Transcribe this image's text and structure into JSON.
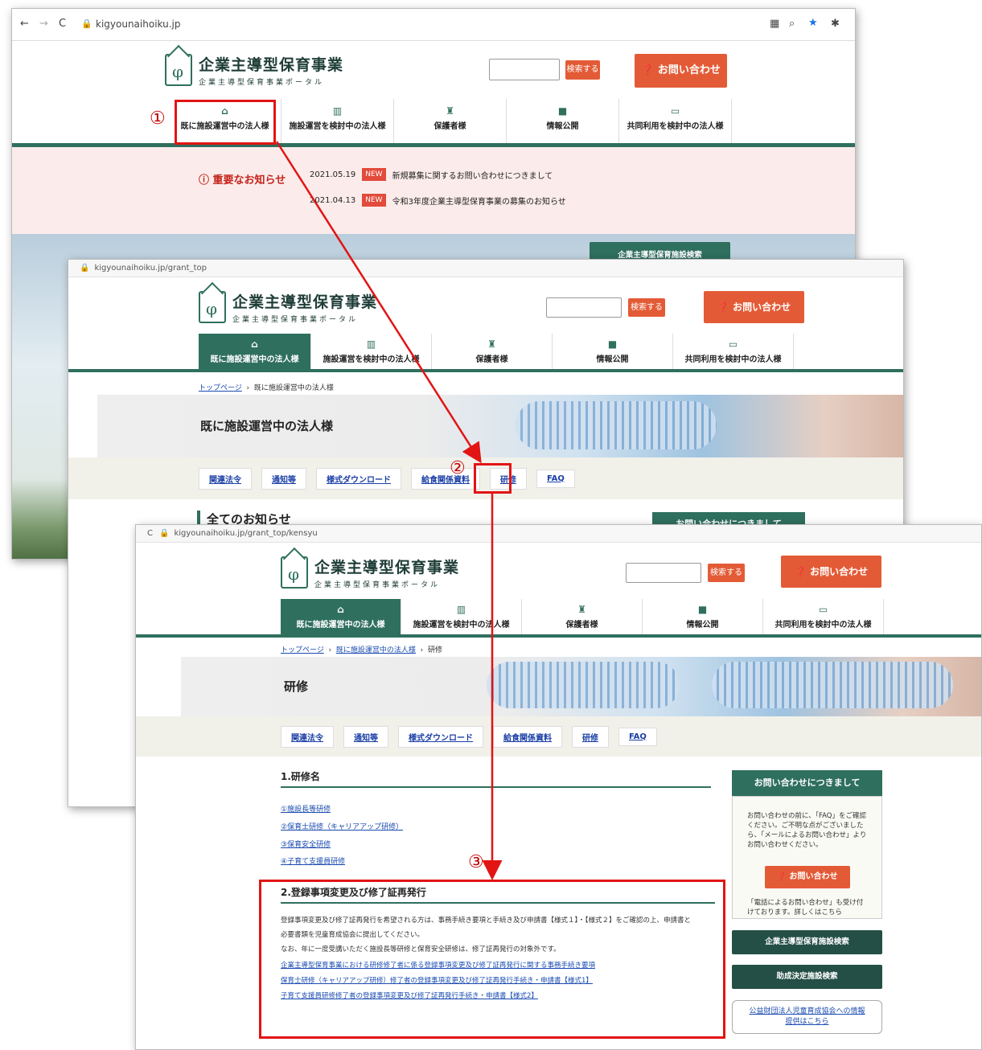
{
  "site": {
    "name": "企業主導型保育事業",
    "sub": "企業主導型保育事業ポータル",
    "search_btn": "検索する",
    "contact_btn": "お問い合わせ"
  },
  "nav": [
    "既に施設運営中の法人様",
    "施設運営を検討中の法人様",
    "保護者様",
    "情報公開",
    "共同利用を検討中の法人様"
  ],
  "nav_icons": [
    "home-icon",
    "building-icon",
    "family-icon",
    "folder-icon",
    "chat-icon"
  ],
  "w1": {
    "url": "kigyounaihoiku.jp",
    "notice_title": "重要なお知らせ",
    "notices": [
      {
        "date": "2021.05.19",
        "badge": "NEW",
        "text": "新規募集に関するお問い合わせにつきまして"
      },
      {
        "date": "2021.04.13",
        "badge": "NEW",
        "text": "令和3年度企業主導型保育事業の募集のお知らせ"
      }
    ],
    "facility_btn": "企業主導型保育施設検索"
  },
  "w2": {
    "url": "kigyounaihoiku.jp/grant_top",
    "crumb_home": "トップページ",
    "crumb_cur": "既に施設運営中の法人様",
    "hero": "既に施設運営中の法人様",
    "all_news": "全てのお知らせ",
    "inq_btn": "お問い合わせにつきまして"
  },
  "tabs": [
    "関連法令",
    "通知等",
    "様式ダウンロード",
    "給食関係資料",
    "研修",
    "FAQ"
  ],
  "w3": {
    "url": "kigyounaihoiku.jp/grant_top/kensyu",
    "crumb_home": "トップページ",
    "crumb_mid": "既に施設運営中の法人様",
    "crumb_cur": "研修",
    "hero": "研修",
    "sec1": "1.研修名",
    "links1": [
      "①施設長等研修",
      "②保育士研修（キャリアアップ研修）",
      "③保育安全研修",
      "④子育て支援員研修"
    ],
    "sec2": "2.登録事項変更及び修了証再発行",
    "p1": "登録事項変更及び修了証再発行を希望される方は、事務手続き要項と手続き及び申請書【様式１】・【様式２】をご確認の上、申請書と",
    "p2": "必要書類を児童育成協会に提出してください。",
    "p3": "なお、年に一度受講いただく施設長等研修と保育安全研修は、修了証再発行の対象外です。",
    "links2": [
      "企業主導型保育事業における研修修了者に係る登録事項変更及び修了証再発行に関する事務手続き要項",
      "保育士研修（キャリアアップ研修）修了者の登録事項変更及び修了証再発行手続き・申請書【様式1】",
      "子育て支援員研修修了者の登録事項変更及び修了証再発行手続き・申請書【様式2】"
    ],
    "side_head": "お問い合わせにつきまして",
    "side_text1": "お問い合わせの前に、「FAQ」をご確認ください。ご不明な点がございましたら、「メールによるお問い合わせ」よりお問い合わせください。",
    "side_contact": "お問い合わせ",
    "side_text2": "「電話によるお問い合わせ」も受け付けております。詳しくはこちら",
    "side_btn1": "企業主導型保育施設検索",
    "side_btn2": "助成決定施設検索",
    "side_btn3": "公益財団法人児童育成協会への情報提供はこちら"
  },
  "markers": [
    "①",
    "②",
    "③"
  ]
}
